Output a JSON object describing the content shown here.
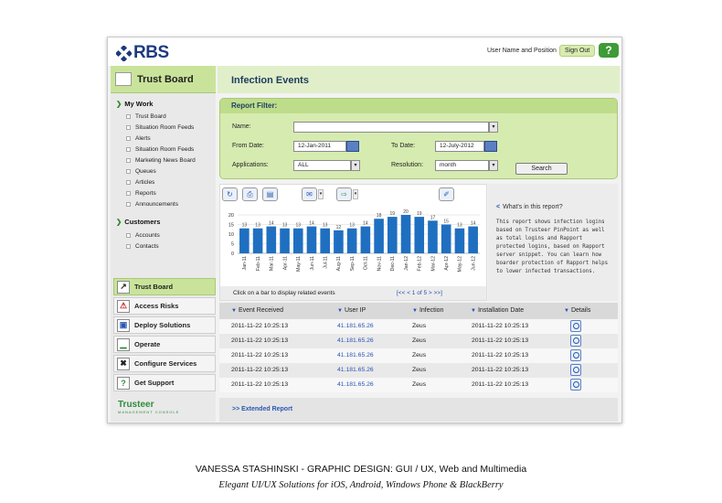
{
  "header": {
    "brand": "RBS",
    "user_label": "User Name and Position",
    "signout_label": "Sign Out",
    "help_label": "?"
  },
  "sidebar": {
    "title": "Trust Board",
    "my_work": {
      "heading": "My Work",
      "items": [
        "Trust Board",
        "Situation Room Feeds",
        "Alerts",
        "Situation Room Feeds",
        "Marketing News Board",
        "Queues",
        "Articles",
        "Reports",
        "Announcements"
      ]
    },
    "customers": {
      "heading": "Customers",
      "items": [
        "Accounts",
        "Contacts"
      ]
    },
    "menu": [
      {
        "label": "Trust Board",
        "icon": "chart-icon"
      },
      {
        "label": "Access Risks",
        "icon": "warning-icon"
      },
      {
        "label": "Deploy Solutions",
        "icon": "deploy-icon"
      },
      {
        "label": "Operate",
        "icon": "operate-icon"
      },
      {
        "label": "Configure Services",
        "icon": "tools-icon"
      },
      {
        "label": "Get Support",
        "icon": "support-icon"
      }
    ],
    "footer_brand": "Trusteer",
    "footer_sub": "MANAGEMENT CONSOLE"
  },
  "main": {
    "title": "Infection Events",
    "filter": {
      "title": "Report Filter:",
      "name_label": "Name:",
      "name_value": "",
      "from_label": "From Date:",
      "from_value": "12-Jan-2011",
      "to_label": "To Date:",
      "to_value": "12-July-2012",
      "apps_label": "Applications:",
      "apps_value": "ALL",
      "res_label": "Resolution:",
      "res_value": "month",
      "search_label": "Search"
    },
    "chart_hint": "Click on a bar to display related events",
    "pager": "[<< < 1 of 5 > >>]",
    "info": {
      "heading": "What's in this report?",
      "body": "This report shows infection logins based on Trusteer PinPoint as well as total logins and Rapport protected logins, based on Rapport server snippet. You can learn how boarder protection of Rapport helps to lower infected transactions."
    },
    "table": {
      "headers": [
        "Event Received",
        "User IP",
        "Infection",
        "Installation Date",
        "Details"
      ],
      "rows": [
        {
          "event": "2011-11-22     10:25:13",
          "ip": "41.181.65.26",
          "infection": "Zeus",
          "install": "2011-11-22     10:25:13"
        },
        {
          "event": "2011-11-22     10:25:13",
          "ip": "41.181.65.26",
          "infection": "Zeus",
          "install": "2011-11-22     10:25:13"
        },
        {
          "event": "2011-11-22     10:25:13",
          "ip": "41.181.65.26",
          "infection": "Zeus",
          "install": "2011-11-22     10:25:13"
        },
        {
          "event": "2011-11-22     10:25:13",
          "ip": "41.181.65.26",
          "infection": "Zeus",
          "install": "2011-11-22     10:25:13"
        },
        {
          "event": "2011-11-22     10:25:13",
          "ip": "41.181.65.26",
          "infection": "Zeus",
          "install": "2011-11-22     10:25:13"
        }
      ],
      "extended_link": ">> Extended Report"
    }
  },
  "chart_data": {
    "type": "bar",
    "categories": [
      "Jan-11",
      "Feb-11",
      "Mar-11",
      "Apr-11",
      "May-11",
      "Jun-11",
      "Jul-11",
      "Aug-11",
      "Sep-11",
      "Oct-11",
      "Nov-11",
      "Dec-11",
      "Jan-12",
      "Feb-12",
      "Mar-12",
      "Apr-12",
      "May-12",
      "Jun-12"
    ],
    "values": [
      13,
      13,
      14,
      13,
      13,
      14,
      13,
      12,
      13,
      14,
      18,
      19,
      20,
      19,
      17,
      15,
      13,
      14
    ],
    "ylim": [
      0,
      20
    ],
    "yticks": [
      0,
      5,
      10,
      15,
      20
    ],
    "color": "#1f6fc1",
    "grid": true
  },
  "captions": {
    "line1": "VANESSA STASHINSKI - GRAPHIC DESIGN: GUI / UX, Web and Multimedia",
    "line2": "Elegant UI/UX Solutions for iOS, Android, Windows Phone & BlackBerry"
  }
}
